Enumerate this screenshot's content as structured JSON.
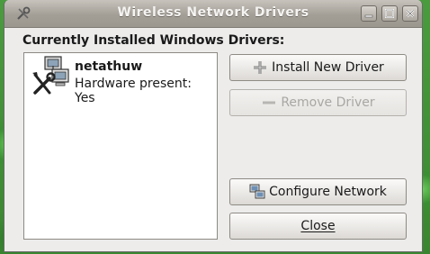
{
  "window": {
    "title": "Wireless Network Drivers"
  },
  "main": {
    "heading": "Currently Installed Windows Drivers:",
    "drivers": [
      {
        "name": "netathuw",
        "status": "Hardware present: Yes",
        "icon": "network-tools-icon"
      }
    ]
  },
  "buttons": {
    "install": {
      "label": "Install New Driver",
      "icon": "plus-icon",
      "enabled": true
    },
    "remove": {
      "label": "Remove Driver",
      "icon": "minus-icon",
      "enabled": false
    },
    "configure": {
      "label": "Configure Network",
      "icon": "network-computers-icon",
      "enabled": true
    },
    "close": {
      "label": "Close",
      "enabled": true
    }
  },
  "colors": {
    "titlebar": "#a39f97",
    "window_bg": "#edeceb",
    "disabled_text": "#a9a7a3"
  }
}
